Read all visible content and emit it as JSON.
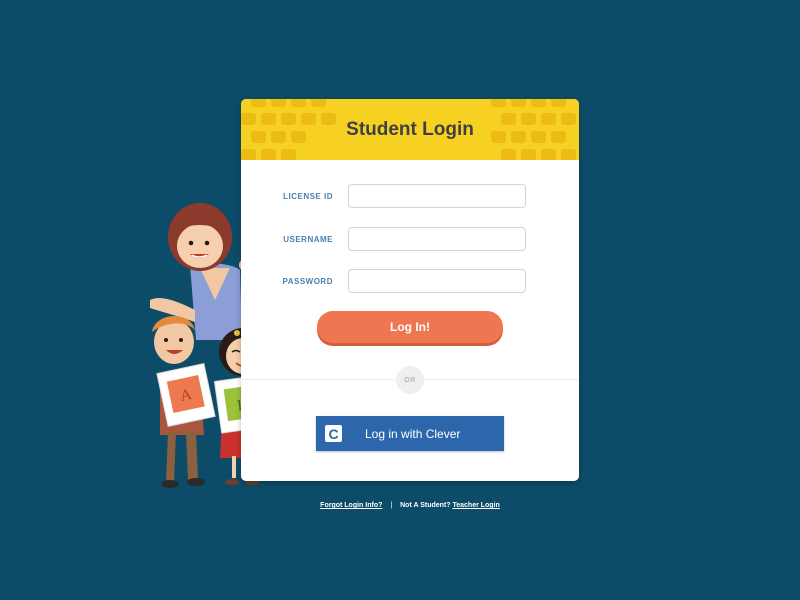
{
  "header": {
    "title": "Student Login"
  },
  "form": {
    "license_id_label": "LICENSE ID",
    "username_label": "USERNAME",
    "password_label": "PASSWORD",
    "license_id_value": "",
    "username_value": "",
    "password_value": "",
    "login_button": "Log In!"
  },
  "divider": {
    "or_label": "OR"
  },
  "clever": {
    "logo_letter": "C",
    "button_label": "Log in with Clever"
  },
  "footer": {
    "forgot_link": "Forgot Login Info?",
    "separator": "|",
    "not_student_text": "Not A Student?",
    "teacher_link": "Teacher Login"
  },
  "illustration": {
    "card_letter_a": "A",
    "card_letter_l": "L"
  },
  "colors": {
    "background": "#0d4c68",
    "header_yellow": "#f7d121",
    "login_button": "#ee7651",
    "clever_blue": "#2e66ac",
    "label_blue": "#4a7fae"
  }
}
